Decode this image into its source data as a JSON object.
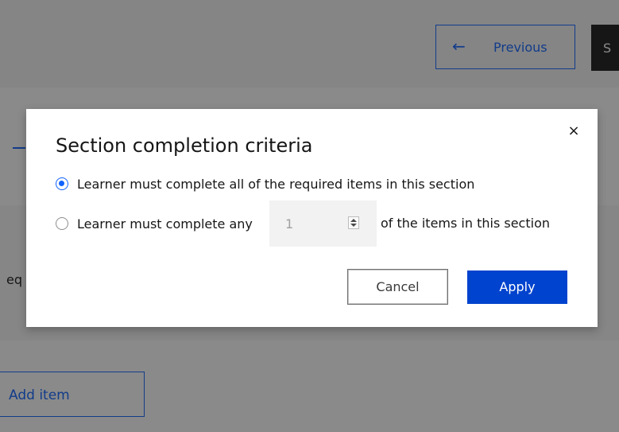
{
  "background": {
    "previous_label": "Previous",
    "previous_arrow": "←",
    "save_label_partial": "S",
    "row_text_partial": "eq",
    "add_item_label": "Add item"
  },
  "modal": {
    "title": "Section completion criteria",
    "close_glyph": "×",
    "options": [
      {
        "label": "Learner must complete all of the required items in this section",
        "selected": true
      },
      {
        "label_prefix": "Learner must complete any",
        "value": "1",
        "label_suffix": "of the items in this section",
        "selected": false
      }
    ],
    "cancel_label": "Cancel",
    "apply_label": "Apply"
  },
  "colors": {
    "primary": "#0f62fe",
    "apply_bg": "#0043ce",
    "overlay": "rgba(22,22,22,0.5)"
  }
}
